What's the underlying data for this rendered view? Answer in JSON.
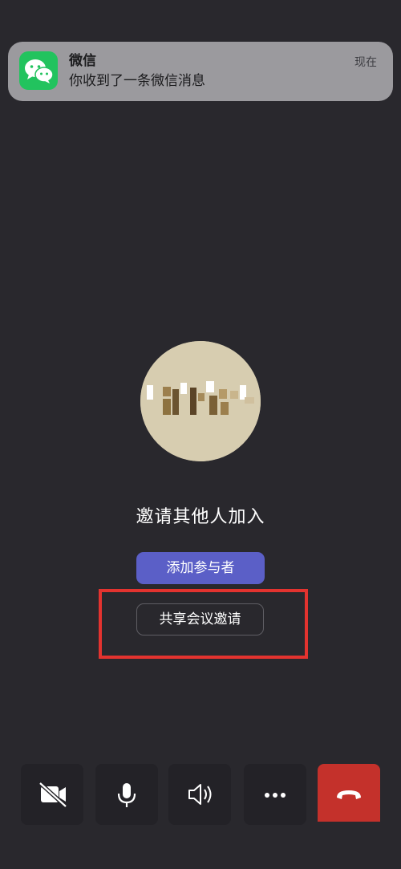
{
  "notification": {
    "app_name": "微信",
    "message": "你收到了一条微信消息",
    "time": "现在",
    "icon": "wechat-icon"
  },
  "avatar": {
    "icon": "avatar-image-pixelated"
  },
  "invite": {
    "title": "邀请其他人加入",
    "add_participants_label": "添加参与者",
    "share_invite_label": "共享会议邀请"
  },
  "controls": {
    "video_icon": "video-off-icon",
    "mic_icon": "microphone-icon",
    "speaker_icon": "speaker-icon",
    "more_icon": "more-options-icon",
    "hangup_icon": "hang-up-icon"
  },
  "colors": {
    "background": "#29282d",
    "accent": "#5b5fc7",
    "hangup": "#c4312b",
    "highlight": "#e3332f",
    "wechat_green": "#22c35e"
  }
}
